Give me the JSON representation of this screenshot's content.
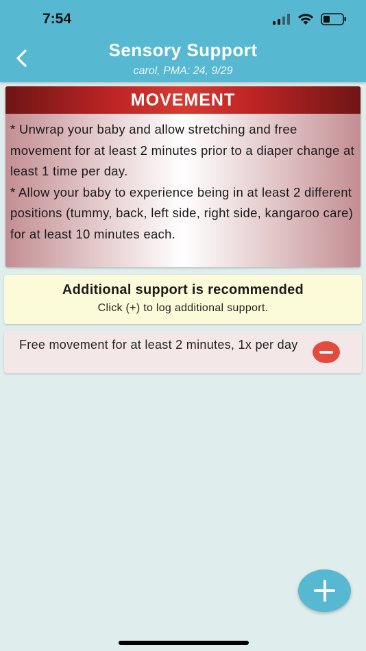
{
  "status_bar": {
    "time": "7:54"
  },
  "nav": {
    "title": "Sensory Support",
    "subtitle": "carol, PMA: 24, 9/29",
    "back_icon": "chevron-left-icon"
  },
  "activity_card": {
    "title": "MOVEMENT",
    "instructions": [
      "* Unwrap your baby and allow stretching and free movement for at least 2 minutes prior to a diaper change at least 1 time per day.",
      "* Allow your baby to experience being in at least 2 different positions (tummy, back, left side, right side, kangaroo care) for at least 10 minutes each."
    ]
  },
  "notice": {
    "title": "Additional support is recommended",
    "subtitle": "Click (+) to log additional support."
  },
  "logged_items": [
    {
      "label": "Free movement for at least 2 minutes, 1x per day",
      "action_icon": "minus-circle-icon"
    }
  ],
  "fab_icon": "plus-icon",
  "colors": {
    "header_bar": "#57b8d2",
    "background": "#dfedec",
    "card_header": "#bd2424",
    "notice_bg": "#fcfbd9",
    "remove_button": "#e24b3d"
  }
}
